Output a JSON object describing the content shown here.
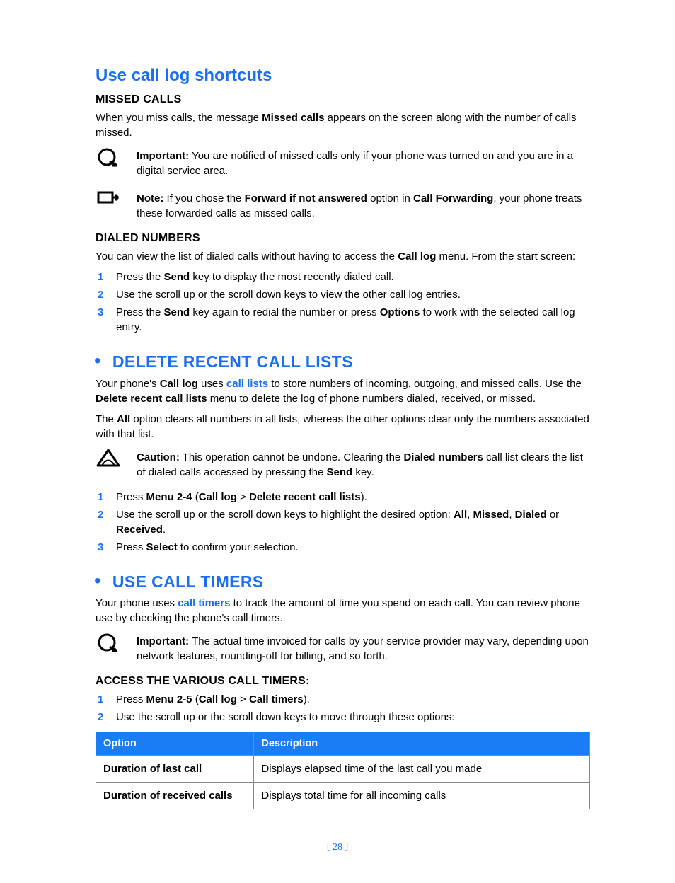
{
  "section_a": {
    "title": "Use call log shortcuts",
    "sub1_title": "MISSED CALLS",
    "sub1_p_a": "When you miss calls, the message ",
    "sub1_p_b": "Missed calls",
    "sub1_p_c": " appears on the screen along with the number of calls missed.",
    "important_label": "Important:",
    "important_text": " You are notified of missed calls only if your phone was turned on and you are in a digital service area.",
    "note_label": "Note:",
    "note_a": " If you chose the ",
    "note_b": "Forward if not answered",
    "note_c": " option in ",
    "note_d": "Call Forwarding",
    "note_e": ", your phone treats these forwarded calls as missed calls.",
    "sub2_title": "DIALED NUMBERS",
    "sub2_p_a": "You can view the list of dialed calls without having to access the ",
    "sub2_p_b": "Call log",
    "sub2_p_c": " menu. From the start screen:",
    "steps": {
      "s1a": "Press the ",
      "s1b": "Send",
      "s1c": " key to display the most recently dialed call.",
      "s2": "Use the scroll up or the scroll down keys to view the other call log entries.",
      "s3a": "Press the ",
      "s3b": "Send",
      "s3c": " key again to redial the number or press ",
      "s3d": "Options",
      "s3e": " to work with the selected call log entry."
    }
  },
  "section_b": {
    "title": "DELETE RECENT CALL LISTS",
    "p1a": "Your phone's ",
    "p1b": "Call log",
    "p1c": " uses ",
    "p1d": "call lists",
    "p1e": " to store numbers of incoming, outgoing, and missed calls. Use the ",
    "p1f": "Delete recent call lists",
    "p1g": " menu to delete the log of phone numbers dialed, received, or missed.",
    "p2a": "The ",
    "p2b": "All",
    "p2c": " option clears all numbers in all lists, whereas the other options clear only the numbers associated with that list.",
    "caution_label": "Caution:",
    "caution_a": " This operation cannot be undone. Clearing the ",
    "caution_b": "Dialed numbers",
    "caution_c": " call list clears the list of dialed calls accessed by pressing the ",
    "caution_d": "Send",
    "caution_e": " key.",
    "steps": {
      "s1a": "Press ",
      "s1b": "Menu 2-4",
      "s1c": " (",
      "s1d": "Call log",
      "s1e": " > ",
      "s1f": "Delete recent call lists",
      "s1g": ").",
      "s2a": "Use the scroll up or the scroll down keys to highlight the desired option: ",
      "s2b": "All",
      "s2c": ", ",
      "s2d": "Missed",
      "s2e": ", ",
      "s2f": "Dialed",
      "s2g": " or ",
      "s2h": "Received",
      "s2i": ".",
      "s3a": "Press ",
      "s3b": "Select",
      "s3c": " to confirm your selection."
    }
  },
  "section_c": {
    "title": "USE CALL TIMERS",
    "p1a": "Your phone uses ",
    "p1b": "call timers",
    "p1c": " to track the amount of time you spend on each call. You can review phone use by checking the phone's call timers.",
    "important_label": "Important:",
    "important_text": " The actual time invoiced for calls by your service provider may vary, depending upon network features, rounding-off for billing, and so forth.",
    "sub_title": "ACCESS THE VARIOUS CALL TIMERS:",
    "steps": {
      "s1a": "Press ",
      "s1b": "Menu 2-5",
      "s1c": " (",
      "s1d": "Call log",
      "s1e": " > ",
      "s1f": "Call timers",
      "s1g": ").",
      "s2": "Use the scroll up or the scroll down keys to move through these options:"
    },
    "table": {
      "h1": "Option",
      "h2": "Description",
      "r1c1": "Duration of last call",
      "r1c2": "Displays elapsed time of the last call you made",
      "r2c1": "Duration of received calls",
      "r2c2": "Displays total time for all incoming calls"
    }
  },
  "page_num": "[ 28 ]",
  "nums": {
    "n1": "1",
    "n2": "2",
    "n3": "3"
  }
}
